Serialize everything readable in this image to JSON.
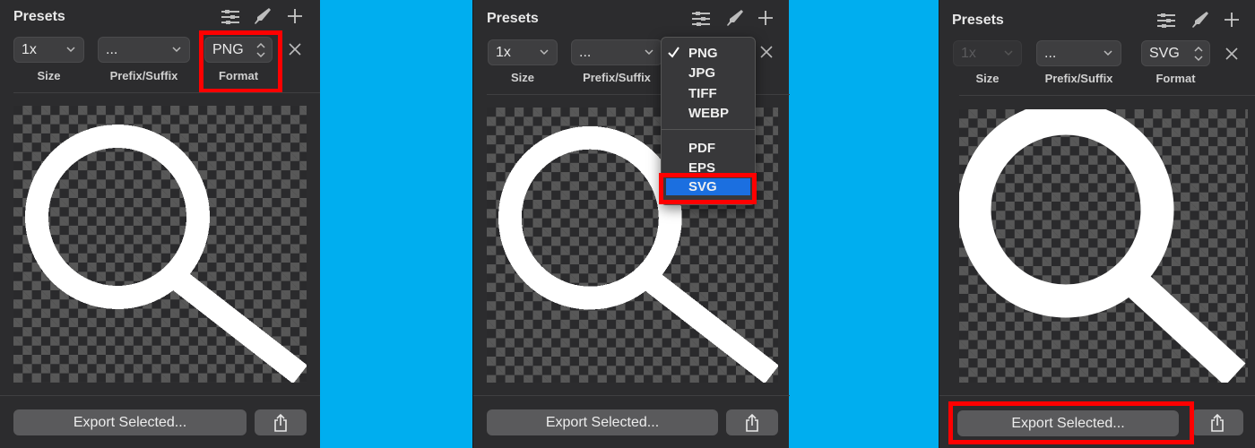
{
  "colors": {
    "background": "#00AEEF",
    "panel": "#2C2C2E",
    "highlight": "#FF0000",
    "menu_selection": "#1B6FE0"
  },
  "panels": [
    {
      "title": "Presets",
      "header_icons": [
        "sliders-icon",
        "knife-icon",
        "plus-icon"
      ],
      "size": {
        "value": "1x",
        "label": "Size",
        "disabled": false
      },
      "prefix_suffix": {
        "value": "...",
        "label": "Prefix/Suffix"
      },
      "format": {
        "value": "PNG",
        "label": "Format"
      },
      "preview_style": "pixelated",
      "export_label": "Export Selected...",
      "highlight": "format"
    },
    {
      "title": "Presets",
      "header_icons": [
        "sliders-icon",
        "knife-icon",
        "plus-icon"
      ],
      "size": {
        "value": "1x",
        "label": "Size",
        "disabled": false
      },
      "prefix_suffix": {
        "value": "...",
        "label": "Prefix/Suffix"
      },
      "format": {
        "value": "PNG",
        "label": "Format"
      },
      "format_menu": {
        "groups": [
          [
            "PNG",
            "JPG",
            "TIFF",
            "WEBP"
          ],
          [
            "PDF",
            "EPS",
            "SVG"
          ]
        ],
        "checked": "PNG",
        "hovered": "SVG"
      },
      "preview_style": "pixelated",
      "export_label": "Export Selected...",
      "highlight": "svg-menu-item"
    },
    {
      "title": "Presets",
      "header_icons": [
        "sliders-icon",
        "knife-icon",
        "plus-icon"
      ],
      "size": {
        "value": "1x",
        "label": "Size",
        "disabled": true
      },
      "prefix_suffix": {
        "value": "...",
        "label": "Prefix/Suffix"
      },
      "format": {
        "value": "SVG",
        "label": "Format"
      },
      "preview_style": "vector",
      "export_label": "Export Selected...",
      "highlight": "export-button"
    }
  ]
}
